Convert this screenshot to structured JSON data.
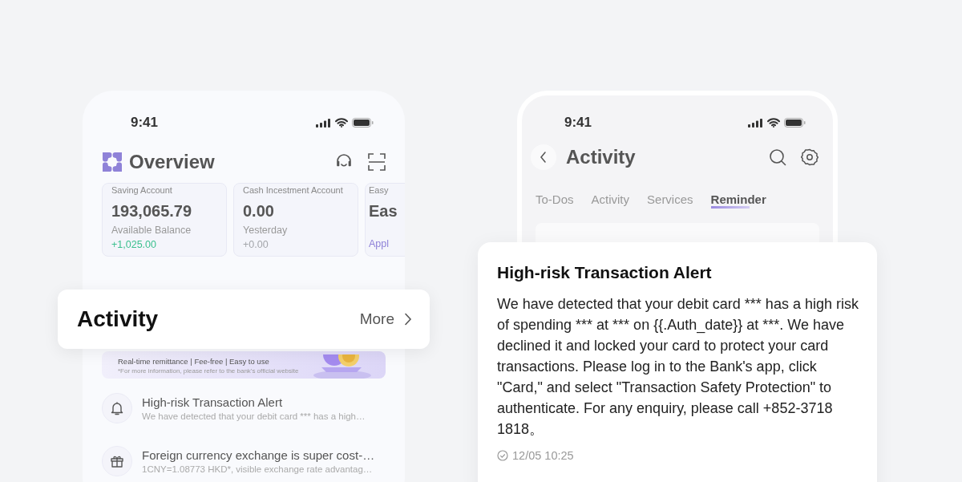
{
  "overview_phone": {
    "status_time": "9:41",
    "title": "Overview",
    "accounts": [
      {
        "label": "Saving Account",
        "value": "193,065.79",
        "caption": "Available Balance",
        "change": "+1,025.00",
        "color": "#3cc08f"
      },
      {
        "label": "Cash Incestment Account",
        "value": "0.00",
        "caption": "Yesterday",
        "change": "+0.00",
        "color": "#a4a6ab"
      },
      {
        "label": "Easy",
        "value": "Eas",
        "link": "Appl"
      }
    ],
    "banner": {
      "tagline": "Real-time remittance | Fee-free | Easy to use",
      "note": "*For more information, please refer to the bank's official website"
    },
    "messages": [
      {
        "kind": "bell",
        "title": "High-risk Transaction Alert",
        "preview": "We have detected that your debit card *** has a high…"
      },
      {
        "kind": "gift",
        "title": "Foreign currency exchange is super cost-…",
        "preview": "1CNY=1.08773 HKD*, visible exchange rate advantag…"
      }
    ]
  },
  "activity_callout": {
    "title": "Activity",
    "more": "More"
  },
  "activity_phone": {
    "status_time": "9:41",
    "title": "Activity",
    "tabs": [
      {
        "label": "To-Dos",
        "selected": false
      },
      {
        "label": "Activity",
        "selected": false
      },
      {
        "label": "Services",
        "selected": false
      },
      {
        "label": "Reminder",
        "selected": true
      }
    ]
  },
  "alert_card": {
    "title": "High-risk Transaction Alert",
    "body": "We have detected that your debit card *** has a high risk of spending *** at *** on {{.Auth_date}} at ***. We have declined it and locked your card to protect your card transactions. Please log in to the Bank's app, click \"Card,\" and select \"Transaction Safety Protection\" to authenticate. For any enquiry, please call +852-3718 1818。",
    "time": "12/05 10:25"
  }
}
